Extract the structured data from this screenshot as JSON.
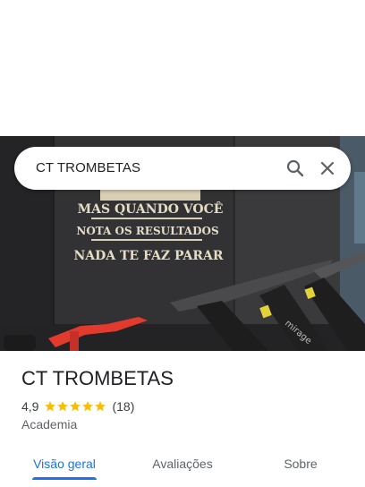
{
  "search": {
    "query": "CT TROMBETAS"
  },
  "hero_photo": {
    "wall_text": [
      "MAS QUANDO VOCÊ",
      "NOTA OS RESULTADOS",
      "NADA TE FAZ PARAR"
    ],
    "equipment_brand": "mirage"
  },
  "place": {
    "name": "CT TROMBETAS",
    "rating": "4,9",
    "stars": 5,
    "review_count": "(18)",
    "category": "Academia"
  },
  "tabs": [
    {
      "label": "Visão geral",
      "active": true
    },
    {
      "label": "Avaliações",
      "active": false
    },
    {
      "label": "Sobre",
      "active": false
    }
  ],
  "colors": {
    "accent": "#1a73e8",
    "star": "#fbbc04"
  }
}
